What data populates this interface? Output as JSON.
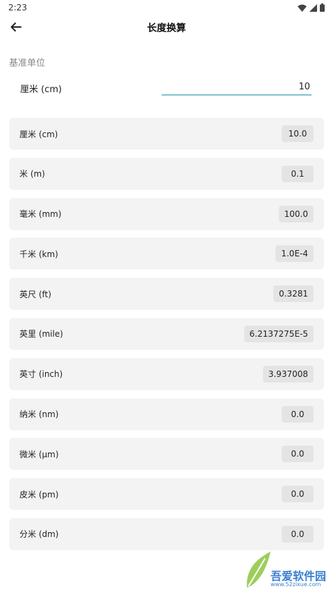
{
  "status_bar": {
    "time": "2:23"
  },
  "header": {
    "title": "长度换算"
  },
  "base": {
    "section_label": "基准单位",
    "unit_label": "厘米 (cm)",
    "input_value": "10"
  },
  "results": [
    {
      "name": "厘米 (cm)",
      "value": "10.0"
    },
    {
      "name": "米 (m)",
      "value": "0.1"
    },
    {
      "name": "毫米 (mm)",
      "value": "100.0"
    },
    {
      "name": "千米 (km)",
      "value": "1.0E-4"
    },
    {
      "name": "英尺 (ft)",
      "value": "0.3281"
    },
    {
      "name": "英里 (mile)",
      "value": "6.2137275E-5"
    },
    {
      "name": "英寸 (inch)",
      "value": "3.937008"
    },
    {
      "name": "纳米 (nm)",
      "value": "0.0"
    },
    {
      "name": "微米 (μm)",
      "value": "0.0"
    },
    {
      "name": "皮米 (pm)",
      "value": "0.0"
    },
    {
      "name": "分米 (dm)",
      "value": "0.0"
    }
  ],
  "watermark": {
    "brand": "吾爱软件园",
    "url": "www.52zixue.com"
  },
  "colors": {
    "accent_underline": "#7fc3cc",
    "card_bg": "#f3f3f3",
    "value_bg": "#e4e4e4"
  }
}
